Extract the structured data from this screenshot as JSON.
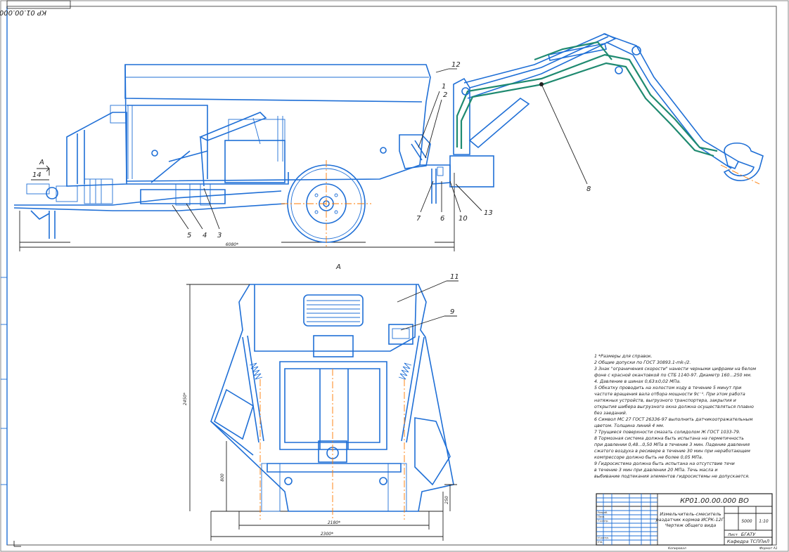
{
  "stamp_rotated": "КР 01.00.000000 ВО",
  "front_view": {
    "dimensions": {
      "overall_length": "6080*"
    },
    "section_marker": "А"
  },
  "view_a": {
    "title": "А",
    "dimensions": {
      "height": "2450*",
      "height_low": "800",
      "track": "2180*",
      "width": "2300*",
      "clearance": "250"
    }
  },
  "positions": [
    "1",
    "2",
    "3",
    "4",
    "5",
    "6",
    "7",
    "8",
    "9",
    "10",
    "11",
    "12",
    "13",
    "14"
  ],
  "notes": [
    "1  *Размеры для справок.",
    "2  Общие допуски по ГОСТ 30893.1-mk-/2.",
    "3  Знак \"ограничения скорости\" нанести черными цифрами на белом",
    "фоне с красной окантовкой по СТБ 1140-97. Диаметр 160...250 мм.",
    "4.  Давление в шинах 0,63±0,02 МПа.",
    "5  Обкатку проводить на холостом ходу в течение 5 минут при",
    "частоте вращения вала отбора мощности 9c⁻¹. При этом работа",
    "натяжных устройств, выгрузного транспортера, закрытия и",
    "открытия шибера выгрузного окна должна осуществляться плавно",
    "без заеданий.",
    "6  Символ МС 27 ГОСТ 26336-97 выполнить датчикоотражательным",
    "цветом. Толщина линий 4 мм.",
    "7  Трущиеся поверхности смазать солидолом Ж ГОСТ 1033-79.",
    "8  Тормозная система должна быть испытана на герметичность",
    "при давлении 0,48...0,50 МПа в течение 3 мин. Падение давления",
    "сжатого воздуха в ресивере в течение 30 мин при неработающем",
    "компрессоре должно быть не более 0,05 МПа.",
    "9  Гидросистема должна быть испытана на отсутствие течи",
    "в течение 3 мин при давлении 20 МПа. Течь масла и",
    "выбивание подтекания элементов гидросистемы не допускается."
  ],
  "title_block": {
    "doc_number": "КР01.00.00.000 ВО",
    "name_line1": "Измельчитель-смеситель",
    "name_line2": "раздатчик кормов ИСРК-12Г.",
    "name_line3": "Чертеж общего вида",
    "mass": "5000",
    "scale": "1:10",
    "sheet": "Лист",
    "organization": "БГАТУ",
    "department": "Кафедра ТСППиЛ",
    "format": "Формат А1",
    "copied": "Копировал",
    "roles": [
      "Разраб.",
      "Пров.",
      "Т.контр.",
      "Н.контр.",
      "Утв."
    ]
  },
  "colors": {
    "line": "#1f6fd6",
    "hydraulics": "#1f8a70",
    "axis": "#ff7a00",
    "text": "#222222"
  }
}
